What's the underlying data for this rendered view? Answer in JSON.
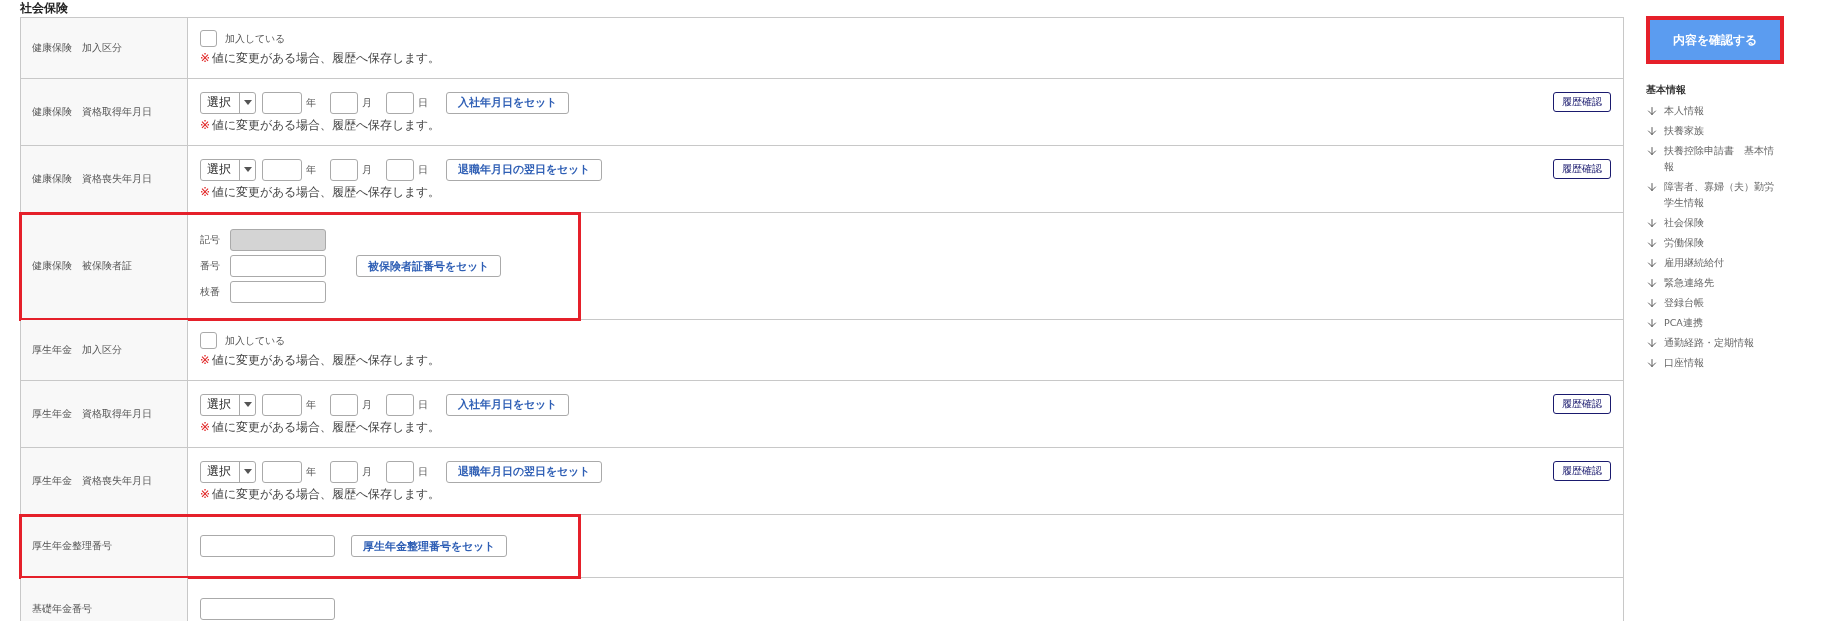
{
  "section_title": "社会保険",
  "rows": [
    {
      "kind": "checkbox",
      "label": "健康保険　加入区分",
      "checkbox_label": "加入している",
      "checked": false,
      "note_mark": "※",
      "note": "値に変更がある場合、履歴へ保存します。",
      "highlighted": false
    },
    {
      "kind": "date",
      "label": "健康保険　資格取得年月日",
      "select": "選択",
      "year_unit": "年",
      "month_unit": "月",
      "day_unit": "日",
      "set_button": "入社年月日をセット",
      "history_button": "履歴確認",
      "note_mark": "※",
      "note": "値に変更がある場合、履歴へ保存します。",
      "highlighted": false
    },
    {
      "kind": "date",
      "label": "健康保険　資格喪失年月日",
      "select": "選択",
      "year_unit": "年",
      "month_unit": "月",
      "day_unit": "日",
      "set_button": "退職年月日の翌日をセット",
      "history_button": "履歴確認",
      "note_mark": "※",
      "note": "値に変更がある場合、履歴へ保存します。",
      "highlighted": false
    },
    {
      "kind": "card",
      "label": "健康保険　被保険者証",
      "fields": [
        {
          "label": "記号",
          "disabled": true
        },
        {
          "label": "番号",
          "disabled": false
        },
        {
          "label": "枝番",
          "disabled": false
        }
      ],
      "set_button": "被保険者証番号をセット",
      "highlighted": true
    },
    {
      "kind": "checkbox",
      "label": "厚生年金　加入区分",
      "checkbox_label": "加入している",
      "checked": false,
      "note_mark": "※",
      "note": "値に変更がある場合、履歴へ保存します。",
      "highlighted": false
    },
    {
      "kind": "date",
      "label": "厚生年金　資格取得年月日",
      "select": "選択",
      "year_unit": "年",
      "month_unit": "月",
      "day_unit": "日",
      "set_button": "入社年月日をセット",
      "history_button": "履歴確認",
      "note_mark": "※",
      "note": "値に変更がある場合、履歴へ保存します。",
      "highlighted": false
    },
    {
      "kind": "date",
      "label": "厚生年金　資格喪失年月日",
      "select": "選択",
      "year_unit": "年",
      "month_unit": "月",
      "day_unit": "日",
      "set_button": "退職年月日の翌日をセット",
      "history_button": "履歴確認",
      "note_mark": "※",
      "note": "値に変更がある場合、履歴へ保存します。",
      "highlighted": false
    },
    {
      "kind": "number",
      "label": "厚生年金整理番号",
      "set_button": "厚生年金整理番号をセット",
      "highlighted": true
    },
    {
      "kind": "number",
      "label": "基礎年金番号",
      "highlighted": false
    }
  ],
  "confirm_button": {
    "label": "内容を確認する",
    "highlighted": true
  },
  "nav": {
    "heading": "基本情報",
    "items": [
      "本人情報",
      "扶養家族",
      "扶養控除申請書　基本情報",
      "障害者、寡婦（夫）勤労学生情報",
      "社会保険",
      "労働保険",
      "雇用継続給付",
      "緊急連絡先",
      "登録台帳",
      "PCA連携",
      "通勤経路・定期情報",
      "口座情報"
    ]
  }
}
